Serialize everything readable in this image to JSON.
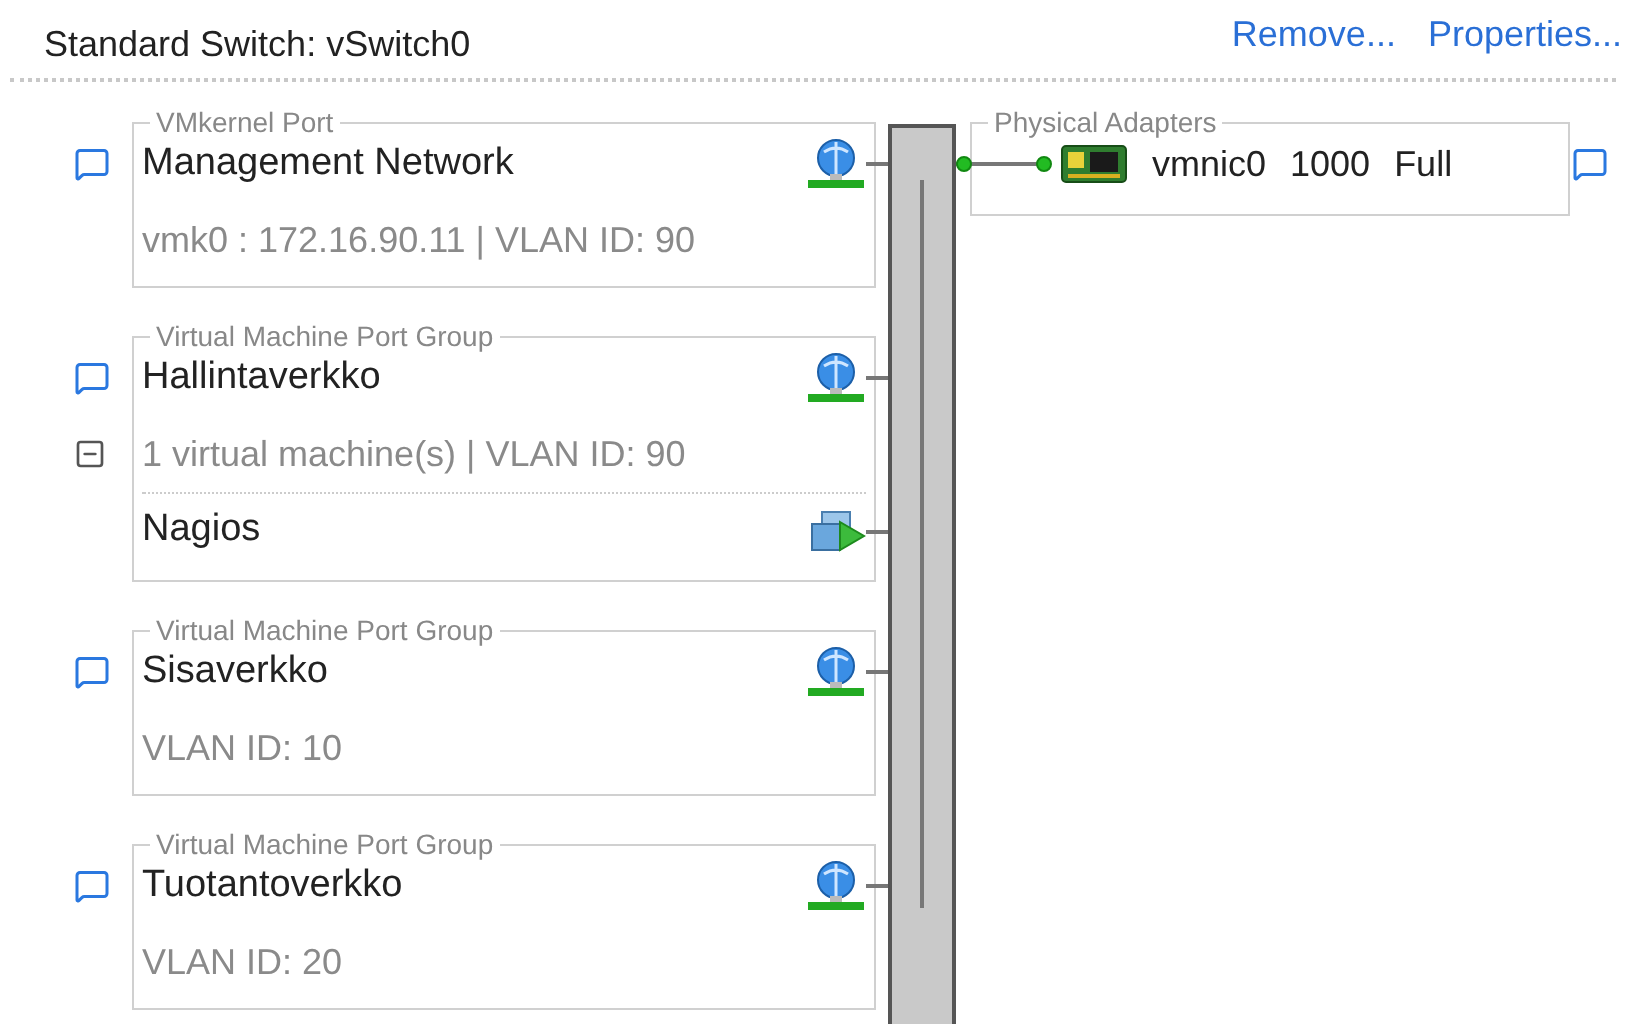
{
  "header": {
    "title": "Standard Switch: vSwitch0",
    "links": [
      "Remove...",
      "Properties..."
    ]
  },
  "groups": [
    {
      "legend": "VMkernel Port",
      "name": "Management Network",
      "details": "vmk0 : 172.16.90.11 | VLAN ID: 90"
    },
    {
      "legend": "Virtual Machine Port Group",
      "name": "Hallintaverkko",
      "details": "1 virtual machine(s) | VLAN ID: 90",
      "expanded": true,
      "machines": [
        {
          "name": "Nagios"
        }
      ]
    },
    {
      "legend": "Virtual Machine Port Group",
      "name": "Sisaverkko",
      "details": "VLAN ID: 10"
    },
    {
      "legend": "Virtual Machine Port Group",
      "name": "Tuotantoverkko",
      "details": "VLAN ID: 20"
    }
  ],
  "physical": {
    "legend": "Physical Adapters",
    "adapters": [
      {
        "name": "vmnic0",
        "speed": "1000",
        "duplex": "Full"
      }
    ]
  }
}
